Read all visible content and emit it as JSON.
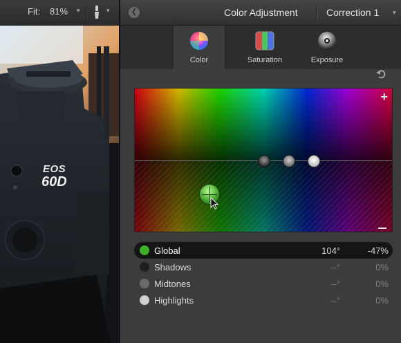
{
  "viewer": {
    "fit_label": "Fit:",
    "zoom": "81%",
    "camera_brand_text": "EOS",
    "camera_model_text": "60D"
  },
  "panel": {
    "title": "Color Adjustment",
    "correction": "Correction 1",
    "tabs": [
      {
        "label": "Color",
        "active": true,
        "icon": "color-wheel-icon"
      },
      {
        "label": "Saturation",
        "active": false,
        "icon": "saturation-icon"
      },
      {
        "label": "Exposure",
        "active": false,
        "icon": "exposure-icon"
      }
    ],
    "board": {
      "plus": "+",
      "minus": "−",
      "pucks": [
        "shadows-puck",
        "midtones-puck",
        "highlights-puck",
        "global-puck"
      ]
    },
    "rows": [
      {
        "label": "Global",
        "angle": "104°",
        "value": "-47%",
        "active": true,
        "dot_color": "#3fae2a"
      },
      {
        "label": "Shadows",
        "angle": "--°",
        "value": "0%",
        "active": false,
        "dot_color": "#1e1e1e"
      },
      {
        "label": "Midtones",
        "angle": "--°",
        "value": "0%",
        "active": false,
        "dot_color": "#6a6a6a"
      },
      {
        "label": "Highlights",
        "angle": "--°",
        "value": "0%",
        "active": false,
        "dot_color": "#cfcfcf"
      }
    ]
  },
  "colors": {
    "accent_green": "#3fae2a",
    "panel_bg": "#3c3c3c",
    "text": "#d8d8d8"
  }
}
